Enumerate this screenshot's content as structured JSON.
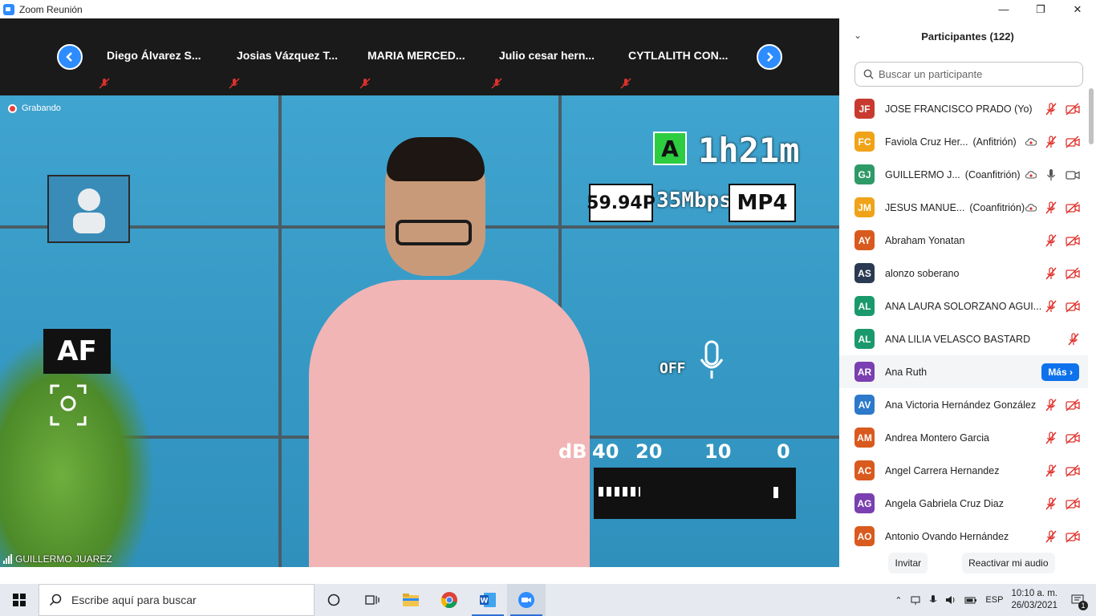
{
  "window": {
    "title": "Zoom Reunión",
    "controls": [
      "—",
      "❐",
      "✕"
    ]
  },
  "gallery": {
    "prev_icon": "chevron-left-icon",
    "next_icon": "chevron-right-icon",
    "thumbnails": [
      {
        "name": "Diego Álvarez S...",
        "muted": true
      },
      {
        "name": "Josias Vázquez T...",
        "muted": true
      },
      {
        "name": "MARIA MERCED...",
        "muted": true
      },
      {
        "name": "Julio cesar hern...",
        "muted": true
      },
      {
        "name": "CYTLALITH CON...",
        "muted": true
      }
    ]
  },
  "main_video": {
    "recording_label": "Grabando",
    "speaker_name": "GUILLERMO JUAREZ",
    "camera_overlay": {
      "mode": "A",
      "remaining": "1h21m",
      "format_rate": "59.94P",
      "bitrate": "35Mbps",
      "container": "MP4",
      "af_label": "AF",
      "mic_label": "OFF",
      "db_labels": [
        "dB",
        "40",
        "20",
        "10",
        "0"
      ]
    }
  },
  "participants": {
    "title": "Participantes (122)",
    "search_placeholder": "Buscar un participante",
    "more_button": "Más",
    "list": [
      {
        "initials": "JF",
        "color": "#c83a2f",
        "name": "JOSE FRANCISCO PRADO (Yo)",
        "role": "",
        "audio": "muted",
        "video": "off",
        "recording": false
      },
      {
        "initials": "FC",
        "color": "#f0a319",
        "name": "Faviola Cruz Her...",
        "role": "(Anfitrión)",
        "audio": "muted",
        "video": "off",
        "recording": "cloud"
      },
      {
        "initials": "GJ",
        "color": "#2e9a66",
        "name": "GUILLERMO J...",
        "role": "(Coanfitrión)",
        "audio": "on",
        "video": "on",
        "recording": "rec"
      },
      {
        "initials": "JM",
        "color": "#f0a319",
        "name": "JESUS MANUE...",
        "role": "(Coanfitrión)",
        "audio": "muted",
        "video": "off",
        "recording": "rec"
      },
      {
        "initials": "AY",
        "color": "#d95a1e",
        "name": "Abraham Yonatan",
        "role": "",
        "audio": "muted",
        "video": "off",
        "recording": false
      },
      {
        "initials": "AS",
        "color": "#2a3a52",
        "name": "alonzo soberano",
        "role": "",
        "audio": "muted",
        "video": "off",
        "recording": false
      },
      {
        "initials": "AL",
        "color": "#1a9a6c",
        "name": "ANA LAURA SOLORZANO AGUI...",
        "role": "",
        "audio": "muted",
        "video": "off",
        "recording": false
      },
      {
        "initials": "AL",
        "color": "#1a9a6c",
        "name": "ANA LILIA VELASCO BASTARD",
        "role": "",
        "audio": "muted",
        "video": "none",
        "recording": false
      },
      {
        "initials": "AR",
        "color": "#7a3fb0",
        "name": "Ana Ruth",
        "role": "",
        "audio": "none",
        "video": "none",
        "recording": false,
        "hover": true
      },
      {
        "initials": "AV",
        "color": "#2c7ac9",
        "name": "Ana Victoria Hernández González",
        "role": "",
        "audio": "muted",
        "video": "off",
        "recording": false
      },
      {
        "initials": "AM",
        "color": "#d95a1e",
        "name": "Andrea Montero Garcia",
        "role": "",
        "audio": "muted",
        "video": "off",
        "recording": false
      },
      {
        "initials": "AC",
        "color": "#d95a1e",
        "name": "Angel Carrera Hernandez",
        "role": "",
        "audio": "muted",
        "video": "off",
        "recording": false
      },
      {
        "initials": "AG",
        "color": "#7a3fb0",
        "name": "Angela Gabriela Cruz Diaz",
        "role": "",
        "audio": "muted",
        "video": "off",
        "recording": false
      },
      {
        "initials": "AO",
        "color": "#d95a1e",
        "name": "Antonio Ovando Hernández",
        "role": "",
        "audio": "muted",
        "video": "off",
        "recording": false
      }
    ],
    "footer": {
      "invite": "Invitar",
      "unmute": "Reactivar mi audio"
    }
  },
  "taskbar": {
    "search_placeholder": "Escribe aquí para buscar",
    "apps": [
      "cortana-icon",
      "task-view-icon",
      "file-explorer-icon",
      "chrome-icon",
      "word-icon",
      "zoom-icon"
    ],
    "language": "ESP",
    "time": "10:10 a. m.",
    "date": "26/03/2021",
    "notifications": "1"
  },
  "colors": {
    "zoom_blue": "#2d8cff",
    "more_button": "#0e72ed",
    "muted_red": "#e0312b"
  }
}
